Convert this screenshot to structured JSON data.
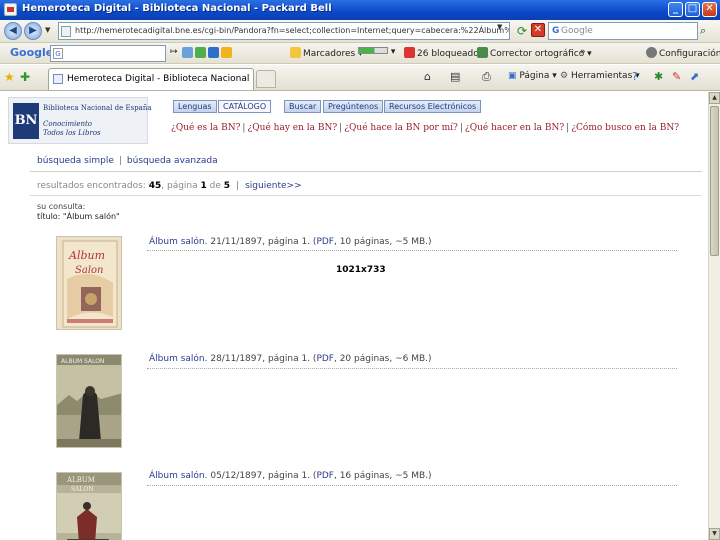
{
  "window": {
    "title": "Hemeroteca Digital - Biblioteca Nacional - Packard Bell"
  },
  "address_bar": {
    "url": "http://hemerotecadigital.bne.es/cgi-bin/Pandora?fn=select;collection=Internet;query=cabecera:%22Álbum%20Salón%22%"
  },
  "search_box": {
    "placeholder": "Google"
  },
  "google_toolbar": {
    "logo": "Google",
    "bookmarks": "Marcadores",
    "pagerank": "PageRank",
    "blocked": "26 bloqueados",
    "spellcheck": "Corrector ortográfico",
    "more": "»",
    "settings": "Configuración"
  },
  "tabs": [
    {
      "label": "Hemeroteca Digital - Biblioteca Nacional"
    }
  ],
  "command_bar": {
    "page": "Página",
    "tools": "Herramientas"
  },
  "site": {
    "logo_title": "Biblioteca Nacional de España",
    "logo_tagline": "Conocimiento Todos los Libros",
    "logo_mark": "BN",
    "menu": [
      "Lenguas",
      "CATÁLOGO",
      "Buscar",
      "Pregúntenos",
      "Recursos Electrónicos"
    ],
    "questions": [
      "¿Qué es la BN?",
      "¿Qué hay en la BN?",
      "¿Qué hace la BN por mí?",
      "¿Qué hacer en la BN?",
      "¿Cómo busco en la BN?"
    ],
    "search_links": {
      "simple": "búsqueda simple",
      "advanced": "búsqueda avanzada",
      "separator": "|"
    }
  },
  "results": {
    "found_label": "resultados encontrados:",
    "count": "45",
    "page_label": "página",
    "page": "1",
    "of_label": "de",
    "total_pages": "5",
    "next": "siguiente>>",
    "query_label": "su consulta:",
    "query_value": "título: \"Álbum salón\"",
    "dimension_label": "1021x733",
    "items": [
      {
        "title": "Álbum salón.",
        "date": "21/11/1897, página 1.",
        "pdf": "PDF",
        "info": ", 10 páginas, ~5 MB.)"
      },
      {
        "title": "Álbum salón.",
        "date": "28/11/1897, página 1.",
        "pdf": "PDF",
        "info": ", 20 páginas, ~6 MB.)"
      },
      {
        "title": "Álbum salón.",
        "date": "05/12/1897, página 1.",
        "pdf": "PDF",
        "info": ", 16 páginas, ~5 MB.)"
      }
    ]
  },
  "colors": {
    "link_blue": "#2b3c8f",
    "question_red": "#9a1e28",
    "titlebar_blue": "#0a49c9"
  }
}
